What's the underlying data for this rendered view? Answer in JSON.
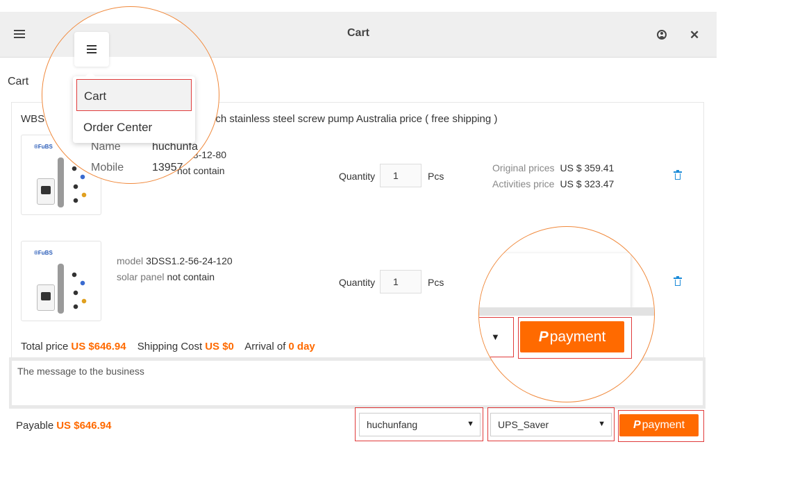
{
  "header": {
    "title": "Cart"
  },
  "page": {
    "section_label": "Cart"
  },
  "order": {
    "title_prefix": "WBS",
    "title_rest": "nch stainless steel screw pump Australia price ( free shipping )",
    "items": [
      {
        "brand": "®FuBS",
        "line1_value": "28-12-80",
        "line2_value": "not contain",
        "quantity_label": "Quantity",
        "quantity": "1",
        "unit": "Pcs",
        "original_label": "Original prices",
        "original_price": "US $ 359.41",
        "activity_label": "Activities price",
        "activity_price": "US $ 323.47"
      },
      {
        "brand": "®FuBS",
        "model_label": "model",
        "model_value": "3DSS1.2-56-24-120",
        "solar_label": "solar panel",
        "solar_value": "not contain",
        "quantity_label": "Quantity",
        "quantity": "1",
        "unit": "Pcs"
      }
    ],
    "totals": {
      "total_label": "Total price",
      "total_value": "US $646.94",
      "shipping_label": "Shipping Cost",
      "shipping_value": "US $0",
      "arrival_label": "Arrival of",
      "arrival_value": "0 day"
    }
  },
  "message": {
    "placeholder": "The message to the business"
  },
  "footer": {
    "payable_label": "Payable",
    "payable_value": "US $646.94",
    "address_select": "huchunfang",
    "shipping_select": "UPS_Saver",
    "payment_label": "payment"
  },
  "zoom_menu": {
    "items": [
      {
        "label": "Cart"
      },
      {
        "label": "Order Center"
      }
    ],
    "name_label": "Name",
    "name_value": "huchunfa",
    "mobile_label": "Mobile",
    "mobile_value": "13957"
  },
  "zoom_payment": {
    "payment_label": "payment"
  },
  "colors": {
    "accent": "#ff6a00",
    "highlight": "#e03a3a",
    "callout": "#f0883a",
    "icon_blue": "#1a8ad8"
  }
}
